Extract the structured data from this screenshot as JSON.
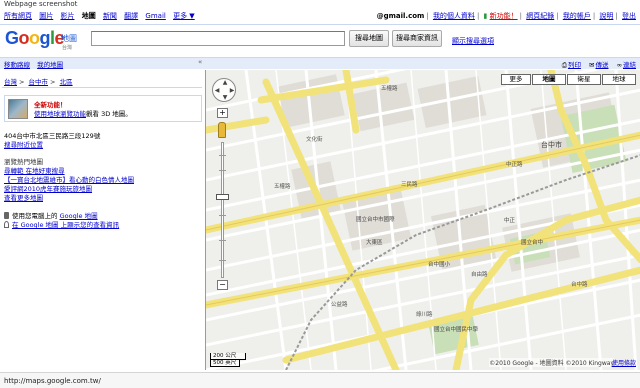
{
  "caption": "Webpage screenshot",
  "gbar": {
    "left": [
      "所有網頁",
      "圖片",
      "影片",
      "地圖",
      "新聞",
      "翻譯",
      "Gmail",
      "更多 ▼"
    ],
    "current": "地圖",
    "account": "@gmail.com",
    "right": [
      "我的個人資料",
      "新功能！",
      "網頁紀錄",
      "我的帳戶",
      "說明",
      "登出"
    ]
  },
  "header": {
    "logo_maps": "地圖",
    "logo_sub": "台灣",
    "search_value": "",
    "search_button": "搜尋地圖",
    "local_button": "搜尋商家資訊",
    "options_link": "顯示搜尋選項"
  },
  "topbar": {
    "left": [
      "移動路線",
      "我的地圖"
    ],
    "collapse": "«",
    "right": [
      "列印",
      "傳送",
      "連結"
    ]
  },
  "sidebar": {
    "breadcrumb": [
      "台灣",
      "台中市",
      "北區"
    ],
    "new_title": "全新功能！",
    "new_link": "使用地球瀏覽功能",
    "new_text": "觀看 3D 地圖。",
    "address": "404台中市北區三民路三段129號",
    "nearby": "搜尋附近位置",
    "popular_heading": "瀏覽熱門地圖",
    "popular_links": [
      "尋轉範 在地好東搜尋",
      "【一寶台北地震維市】看心動的白色情人地圖",
      "愛評網2010虎年賽施玩旅地圖",
      "查看更多地圖"
    ],
    "misc1_text": "使用您電腦上的 ",
    "misc1_link": "Google 地圖",
    "misc2_link": "在 Google 地圖 上顯示您的查看資訊"
  },
  "map": {
    "types": [
      "更多",
      "地圖",
      "衛星",
      "地球"
    ],
    "active_type": "地圖",
    "scale_km": "200 公尺",
    "scale_ft": "500 英尺",
    "copyright": "©2010 Google - 地圖資料 ©2010 Kingway",
    "terms": "使用條款",
    "labels": [
      {
        "text": "文化街",
        "kind": "road"
      },
      {
        "text": "五權路",
        "kind": "road"
      },
      {
        "text": "五權路",
        "kind": "road"
      },
      {
        "text": "公益路",
        "kind": "road"
      },
      {
        "text": "自由路",
        "kind": "road"
      },
      {
        "text": "三民路",
        "kind": "road"
      },
      {
        "text": "中正路",
        "kind": "road"
      },
      {
        "text": "台中市",
        "kind": "place"
      },
      {
        "text": "中正",
        "kind": "place"
      },
      {
        "text": "國立台中市國際",
        "kind": "place"
      },
      {
        "text": "國立台中",
        "kind": "place"
      },
      {
        "text": "國立台中國民中學",
        "kind": "place"
      },
      {
        "text": "大東區",
        "kind": "place"
      },
      {
        "text": "綠川路",
        "kind": "road"
      },
      {
        "text": "台中路",
        "kind": "road"
      },
      {
        "text": "台中國小",
        "kind": "place"
      }
    ]
  },
  "status": {
    "url": "http://maps.google.com.tw/"
  }
}
